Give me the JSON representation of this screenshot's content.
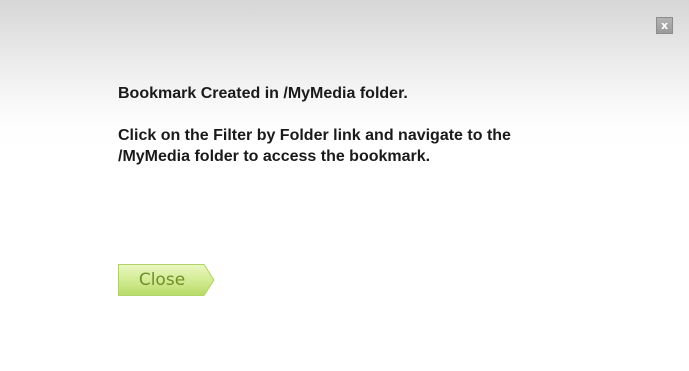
{
  "dialog": {
    "close_icon_glyph": "x",
    "message": {
      "headline": "Bookmark Created in /MyMedia folder.",
      "body": "Click on the Filter by Folder link and navigate to the /MyMedia folder to access the bookmark."
    },
    "close_button_label": "Close",
    "colors": {
      "button_fill_top": "#e6f5b8",
      "button_fill_bottom": "#b9dc6a",
      "button_text": "#6f8f2a",
      "close_icon_bg": "#a8a8a8"
    }
  }
}
